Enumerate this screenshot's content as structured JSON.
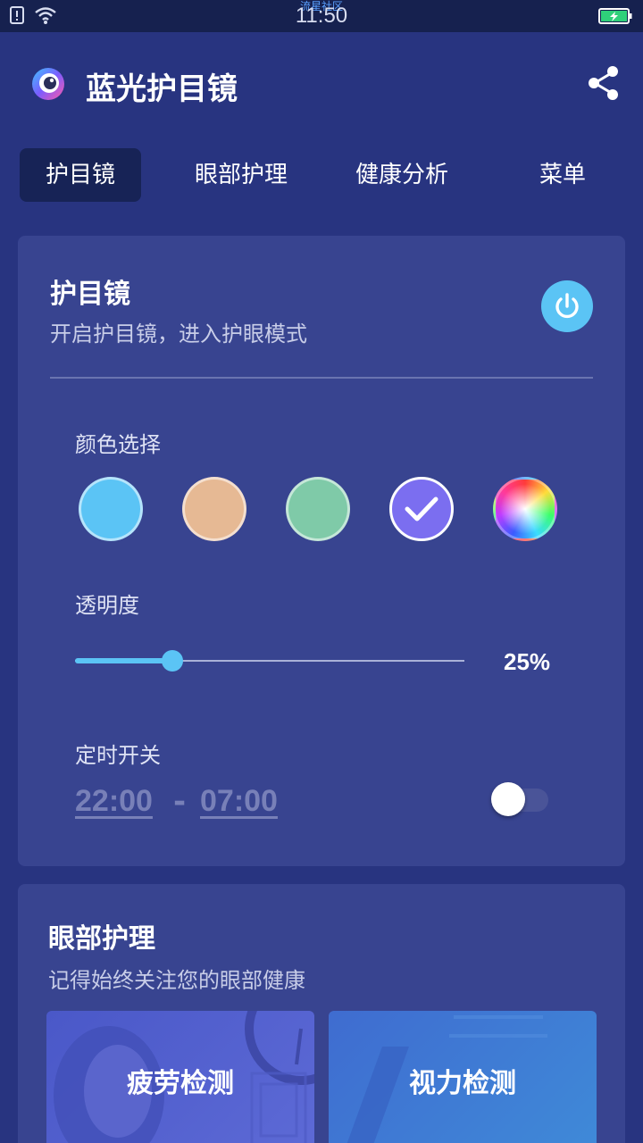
{
  "status": {
    "time": "11:50",
    "watermark": "流星社区"
  },
  "app": {
    "title": "蓝光护目镜"
  },
  "tabs": [
    {
      "label": "护目镜",
      "active": true
    },
    {
      "label": "眼部护理",
      "active": false
    },
    {
      "label": "健康分析",
      "active": false
    },
    {
      "label": "菜单",
      "active": false
    }
  ],
  "eye_shield": {
    "title": "护目镜",
    "subtitle": "开启护目镜，进入护眼模式",
    "power_on": false,
    "color_label": "颜色选择",
    "colors": [
      {
        "name": "blue",
        "hex": "#5bc4f5",
        "selected": false
      },
      {
        "name": "peach",
        "hex": "#e6b994",
        "selected": false
      },
      {
        "name": "green",
        "hex": "#7fcaa8",
        "selected": false
      },
      {
        "name": "purple",
        "hex": "#7b6ef0",
        "selected": true
      },
      {
        "name": "rainbow",
        "hex": "custom",
        "selected": false
      }
    ],
    "opacity_label": "透明度",
    "opacity_value": "25%",
    "opacity_fraction": 0.25,
    "timer_label": "定时开关",
    "timer_start": "22:00",
    "timer_separator": "-",
    "timer_end": "07:00",
    "timer_enabled": false
  },
  "eye_care": {
    "title": "眼部护理",
    "subtitle": "记得始终关注您的眼部健康",
    "features": [
      {
        "label": "疲劳检测"
      },
      {
        "label": "视力检测"
      }
    ]
  },
  "colors": {
    "background": "#283480",
    "card": "#384490",
    "accent": "#5bc4f5",
    "status_bar": "#16214f"
  }
}
